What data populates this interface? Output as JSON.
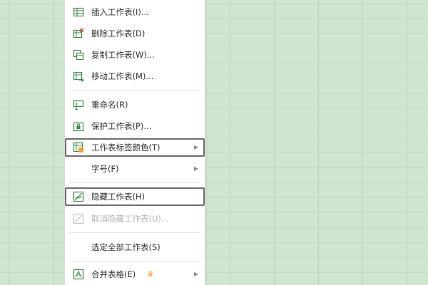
{
  "menu": {
    "insert_sheet": "插入工作表(I)...",
    "delete_sheet": "删除工作表(D)",
    "copy_sheet": "复制工作表(W)...",
    "move_sheet": "移动工作表(M)...",
    "rename": "重命名(R)",
    "protect_sheet": "保护工作表(P)...",
    "tab_color": "工作表标签颜色(T)",
    "font_size": "字号(F)",
    "hide_sheet": "隐藏工作表(H)",
    "unhide_sheet": "取消隐藏工作表(U)...",
    "select_all_sheets": "选定全部工作表(S)",
    "merge_tables": "合并表格(E)"
  },
  "icons": {
    "insert_sheet": "insert-sheet-icon",
    "delete_sheet": "delete-sheet-icon",
    "copy_sheet": "copy-sheet-icon",
    "move_sheet": "move-sheet-icon",
    "rename": "rename-icon",
    "protect_sheet": "protect-sheet-icon",
    "tab_color": "tab-color-icon",
    "hide_sheet": "hide-sheet-icon",
    "unhide_sheet": "unhide-sheet-icon",
    "merge_tables": "merge-tables-icon",
    "premium": "crown-icon",
    "submenu": "chevron-right-icon"
  },
  "colors": {
    "sheet_background": "#cfe5cd",
    "grid_line": "#b9d6b7",
    "icon_green": "#3e8b4d",
    "delete_red": "#d9433b",
    "crown": "#f0a12b",
    "highlight_border": "#6e6e6e"
  }
}
